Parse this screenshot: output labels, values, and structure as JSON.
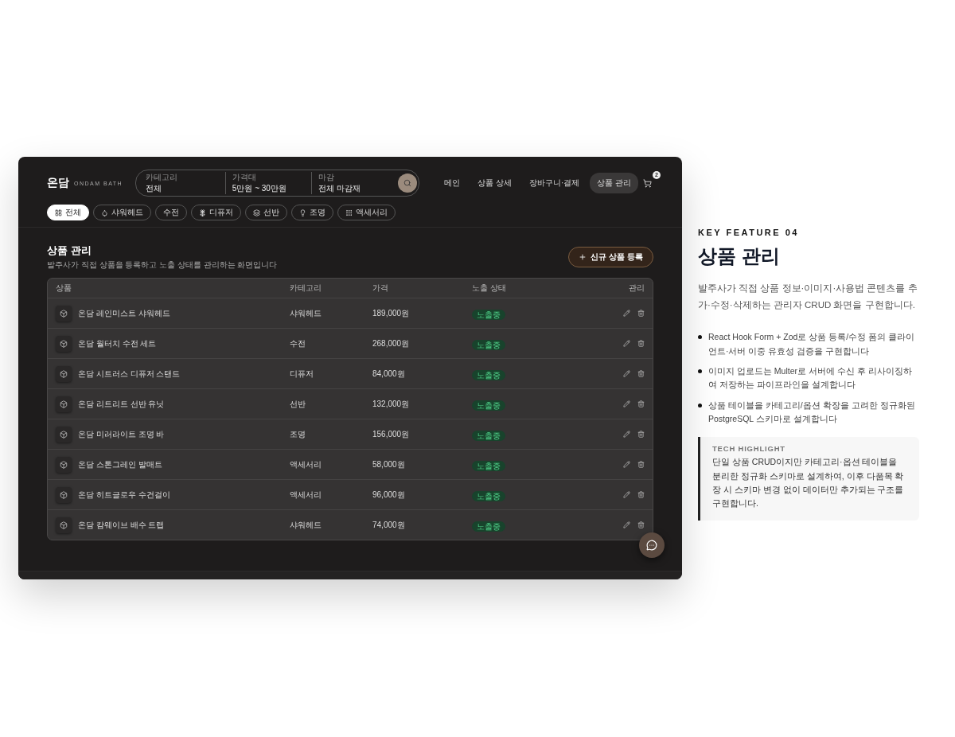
{
  "app": {
    "logo": "온담",
    "logo_sub": "ONDAM BATH",
    "search": [
      {
        "label": "카테고리",
        "value": "전체"
      },
      {
        "label": "가격대",
        "value": "5만원 ~ 30만원"
      },
      {
        "label": "마감",
        "value": "전체 마감재"
      }
    ],
    "nav": [
      {
        "label": "메인",
        "selected": false
      },
      {
        "label": "상품 상세",
        "selected": false
      },
      {
        "label": "장바구니·결제",
        "selected": false
      },
      {
        "label": "상품 관리",
        "selected": true
      }
    ],
    "cart_count": "2",
    "chips": [
      {
        "label": "전체",
        "kind": "grid",
        "selected": true
      },
      {
        "label": "샤워헤드",
        "kind": "drop",
        "selected": false
      },
      {
        "label": "수전",
        "kind": "plain",
        "selected": false
      },
      {
        "label": "디퓨저",
        "kind": "flower",
        "selected": false
      },
      {
        "label": "선반",
        "kind": "layers",
        "selected": false
      },
      {
        "label": "조명",
        "kind": "bulb",
        "selected": false
      },
      {
        "label": "액세서리",
        "kind": "dots",
        "selected": false
      }
    ],
    "page_title": "상품 관리",
    "page_subtitle": "발주사가 직접 상품을 등록하고 노출 상태를 관리하는 화면입니다",
    "new_button": "신규 상품 등록",
    "table": {
      "columns": [
        "상품",
        "카테고리",
        "가격",
        "노출 상태",
        "관리"
      ],
      "rows": [
        {
          "name": "온담 레인미스트 샤워헤드",
          "category": "샤워헤드",
          "price": "189,000원",
          "status": "노출중"
        },
        {
          "name": "온담 월터치 수전 세트",
          "category": "수전",
          "price": "268,000원",
          "status": "노출중"
        },
        {
          "name": "온담 시트러스 디퓨저 스탠드",
          "category": "디퓨저",
          "price": "84,000원",
          "status": "노출중"
        },
        {
          "name": "온담 리트리트 선반 유닛",
          "category": "선반",
          "price": "132,000원",
          "status": "노출중"
        },
        {
          "name": "온담 미러라이트 조명 바",
          "category": "조명",
          "price": "156,000원",
          "status": "노출중"
        },
        {
          "name": "온담 스톤그레인 발매트",
          "category": "액세서리",
          "price": "58,000원",
          "status": "노출중"
        },
        {
          "name": "온담 히트글로우 수건걸이",
          "category": "액세서리",
          "price": "96,000원",
          "status": "노출중"
        },
        {
          "name": "온담 캄웨이브 배수 트랩",
          "category": "샤워헤드",
          "price": "74,000원",
          "status": "노출중"
        }
      ]
    }
  },
  "feature": {
    "eyebrow": "KEY FEATURE 04",
    "title": "상품 관리",
    "description": "발주사가 직접 상품 정보·이미지·사용법 콘텐츠를 추가·수정·삭제하는 관리자 CRUD 화면을 구현합니다.",
    "bullets": [
      "React Hook Form + Zod로 상품 등록/수정 폼의 클라이언트·서버 이중 유효성 검증을 구현합니다",
      "이미지 업로드는 Multer로 서버에 수신 후 리사이징하여 저장하는 파이프라인을 설계합니다",
      "상품 테이블을 카테고리/옵션 확장을 고려한 정규화된 PostgreSQL 스키마로 설계합니다"
    ],
    "highlight": {
      "title": "TECH HIGHLIGHT",
      "text": "단일 상품 CRUD이지만 카테고리·옵션 테이블을 분리한 정규화 스키마로 설계하여, 이후 다품목 확장 시 스키마 변경 없이 데이터만 추가되는 구조를 구현합니다."
    }
  }
}
